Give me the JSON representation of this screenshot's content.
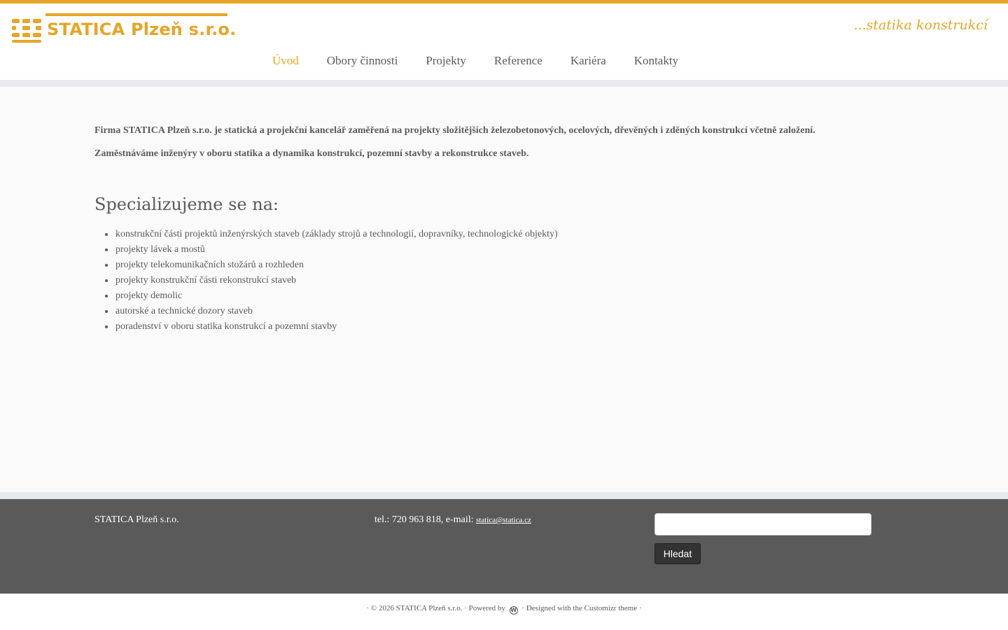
{
  "brand": {
    "logo_text": "STATICA Plzeň s.r.o.",
    "tagline": "...statika konstrukcí",
    "accent_color": "#e6a528"
  },
  "nav": {
    "items": [
      {
        "label": "Úvod",
        "active": true
      },
      {
        "label": "Obory činnosti",
        "active": false
      },
      {
        "label": "Projekty",
        "active": false
      },
      {
        "label": "Reference",
        "active": false
      },
      {
        "label": "Kariéra",
        "active": false
      },
      {
        "label": "Kontakty",
        "active": false
      }
    ]
  },
  "main": {
    "intro_1": "Firma STATICA Plzeň s.r.o. je statická a projekční kancelář zaměřená na projekty složitějších železobetonových, ocelových, dřevěných i zděných konstrukcí včetně založení.",
    "intro_2": "Zaměstnáváme inženýry v oboru statika a dynamika konstrukcí, pozemní stavby a rekonstrukce staveb.",
    "spec_heading": "Specializujeme se na:",
    "spec_items": [
      "konstrukční části projektů inženýrských staveb (základy strojů a technologií, dopravníky, technologické objekty)",
      "projekty lávek a mostů",
      "projekty telekomunikačních stožárů a rozhleden",
      "projekty konstrukční části rekonstrukcí staveb",
      "projekty demolic",
      "autorské a technické dozory staveb",
      "poradenství v oboru statika konstrukcí a pozemní stavby"
    ]
  },
  "footer": {
    "company": "STATICA Plzeň s.r.o.",
    "contact_prefix": "tel.: 720 963 818, e-mail: ",
    "email": "statica@statica.cz",
    "search_value": "",
    "search_button": "Hledat"
  },
  "colophon": {
    "copyright": "· © 2026 STATICA Plzeň s.r.o. · Powered by",
    "designed": "· Designed with the Customizr theme ·",
    "wp_icon": "wordpress-icon"
  }
}
